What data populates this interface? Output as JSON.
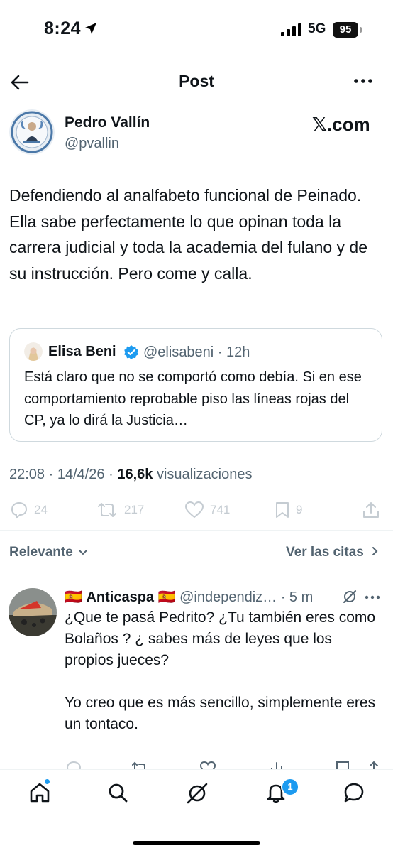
{
  "status_bar": {
    "time": "8:24",
    "network": "5G",
    "battery": "95"
  },
  "nav": {
    "title": "Post"
  },
  "post": {
    "author_name": "Pedro Vallín",
    "author_handle": "@pvallin",
    "source_badge": "𝕏.com",
    "text": "Defendiendo al analfabeto funcional de Peinado. Ella sabe perfectamente lo que opinan toda la carrera judicial y toda la academia del fulano y de su instrucción. Pero come y calla.",
    "quote": {
      "author_name": "Elisa Beni",
      "author_handle": "@elisabeni · 12h",
      "text": "Está claro que no se comportó como debía. Si en ese comportamiento reprobable piso las líneas rojas del CP, ya lo dirá la Justicia…"
    },
    "meta_time": "22:08 · 14/4/26 · ",
    "meta_views": "16,6k",
    "meta_views_label": " visualizaciones",
    "actions": {
      "replies": "24",
      "reposts": "217",
      "likes": "741",
      "bookmarks": "9"
    }
  },
  "filters": {
    "relevance_label": "Relevante",
    "quotes_label": "Ver las citas"
  },
  "reply": {
    "flag": "🇪🇸",
    "author_name": "Anticaspa",
    "author_handle": "@independiz… · 5 m",
    "text": "¿Que te pasá Pedrito? ¿Tu también eres como\nBolaños ? ¿ sabes más de leyes que los propios jueces?\n\nYo creo que es más sencillo, simplemente eres un tontaco."
  },
  "tabbar": {
    "notifications_count": "1"
  },
  "colors": {
    "accent": "#1d9bf0",
    "text": "#0f1419",
    "secondary": "#536471",
    "border": "#cfd9de"
  }
}
